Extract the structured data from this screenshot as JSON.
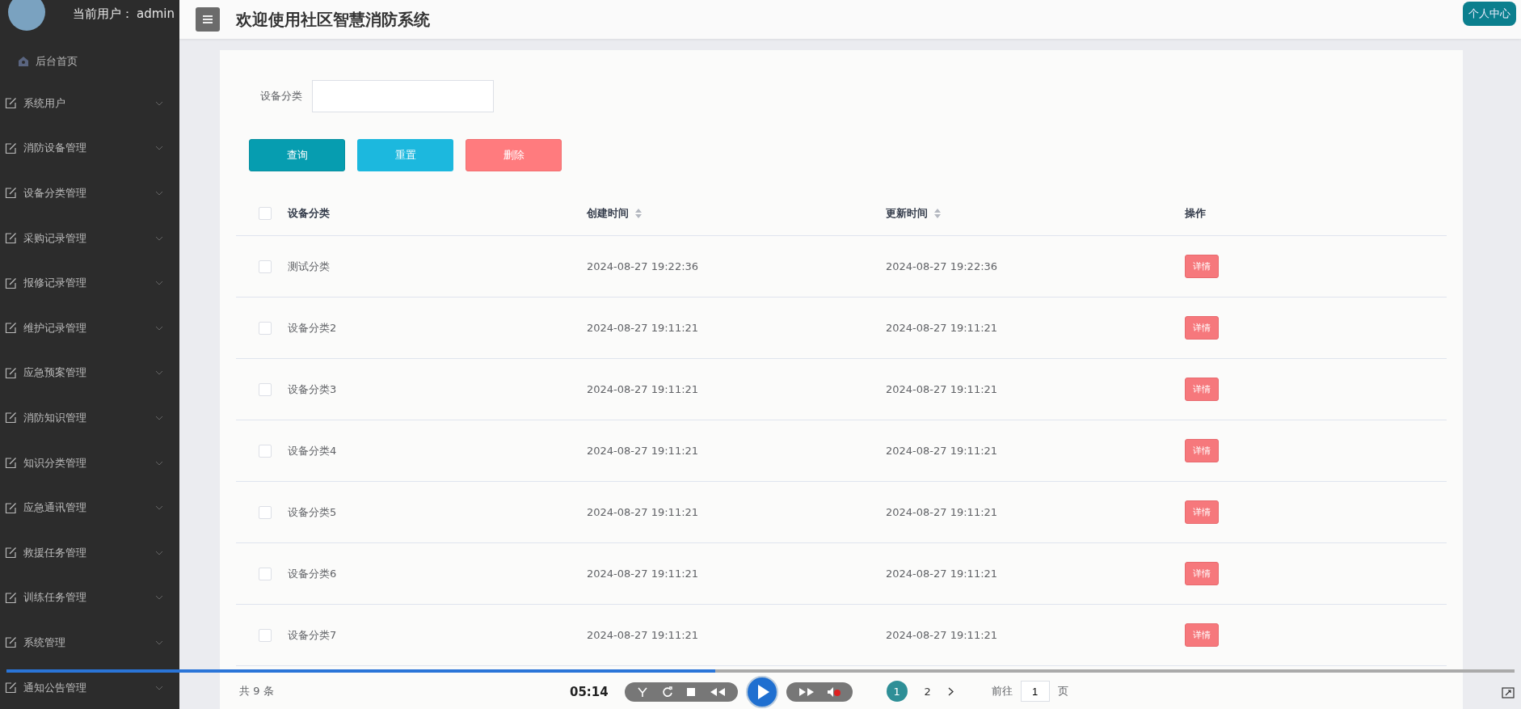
{
  "sidebar": {
    "user_label": "当前用户：",
    "username": "admin",
    "items": [
      {
        "label": "后台首页",
        "kind": "home"
      },
      {
        "label": "系统用户",
        "kind": "menu",
        "expanded": false
      },
      {
        "label": "消防设备管理",
        "kind": "menu",
        "expanded": false
      },
      {
        "label": "设备分类管理",
        "kind": "menu",
        "expanded": false
      },
      {
        "label": "采购记录管理",
        "kind": "menu",
        "expanded": false
      },
      {
        "label": "报修记录管理",
        "kind": "menu",
        "expanded": false
      },
      {
        "label": "维护记录管理",
        "kind": "menu",
        "expanded": false
      },
      {
        "label": "应急预案管理",
        "kind": "menu",
        "expanded": false
      },
      {
        "label": "消防知识管理",
        "kind": "menu",
        "expanded": false
      },
      {
        "label": "知识分类管理",
        "kind": "menu",
        "expanded": false
      },
      {
        "label": "应急通讯管理",
        "kind": "menu",
        "expanded": false
      },
      {
        "label": "救援任务管理",
        "kind": "menu",
        "expanded": false
      },
      {
        "label": "训练任务管理",
        "kind": "menu",
        "expanded": false
      },
      {
        "label": "系统管理",
        "kind": "menu",
        "expanded": false
      },
      {
        "label": "通知公告管理",
        "kind": "menu",
        "expanded": false
      }
    ]
  },
  "header": {
    "title": "欢迎使用社区智慧消防系统",
    "profile_button": "个人中心"
  },
  "search": {
    "label": "设备分类"
  },
  "buttons": [
    {
      "label": "查询",
      "kind": "primary"
    },
    {
      "label": "重置",
      "kind": "info"
    },
    {
      "label": "删除",
      "kind": "danger"
    }
  ],
  "table": {
    "select_all_checked": false,
    "columns": [
      {
        "label": "设备分类",
        "sortable": false
      },
      {
        "label": "创建时间",
        "sortable": true
      },
      {
        "label": "更新时间",
        "sortable": true
      },
      {
        "label": "操作",
        "sortable": false
      }
    ],
    "rows": [
      {
        "checked": false,
        "cells": [
          "测试分类",
          "2024-08-27 19:22:36",
          "2024-08-27 19:22:36"
        ],
        "action": "详情"
      },
      {
        "checked": false,
        "cells": [
          "设备分类2",
          "2024-08-27 19:11:21",
          "2024-08-27 19:11:21"
        ],
        "action": "详情"
      },
      {
        "checked": false,
        "cells": [
          "设备分类3",
          "2024-08-27 19:11:21",
          "2024-08-27 19:11:21"
        ],
        "action": "详情"
      },
      {
        "checked": false,
        "cells": [
          "设备分类4",
          "2024-08-27 19:11:21",
          "2024-08-27 19:11:21"
        ],
        "action": "详情"
      },
      {
        "checked": false,
        "cells": [
          "设备分类5",
          "2024-08-27 19:11:21",
          "2024-08-27 19:11:21"
        ],
        "action": "详情"
      },
      {
        "checked": false,
        "cells": [
          "设备分类6",
          "2024-08-27 19:11:21",
          "2024-08-27 19:11:21"
        ],
        "action": "详情"
      },
      {
        "checked": false,
        "cells": [
          "设备分类7",
          "2024-08-27 19:11:21",
          "2024-08-27 19:11:21"
        ],
        "action": "详情"
      }
    ]
  },
  "pagination": {
    "total": "共 9 条",
    "pages": [
      {
        "label": "1",
        "selected": true
      },
      {
        "label": "2",
        "selected": false
      }
    ],
    "goto_label": "前往",
    "goto_value": "1",
    "goto_suffix": "页"
  },
  "player": {
    "time": "05:14",
    "level": 0.47
  }
}
